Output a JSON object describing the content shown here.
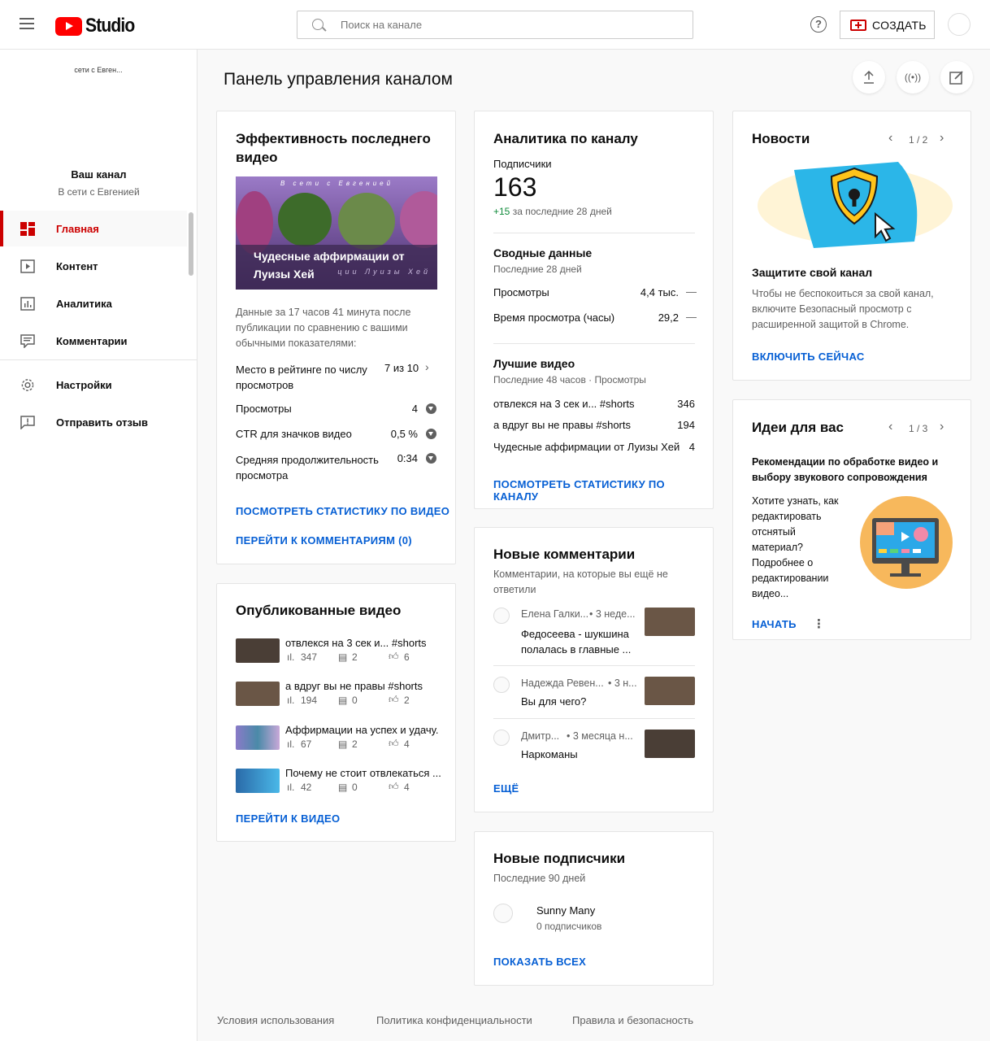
{
  "header": {
    "logo_text": "Studio",
    "search_placeholder": "Поиск на канале",
    "help_icon": "?",
    "create_label": "СОЗДАТЬ"
  },
  "sidebar": {
    "channel_thumb_text": "сети с Евген...",
    "your_channel": "Ваш канал",
    "channel_name": "В сети с Евгенией",
    "items": [
      {
        "label": "Главная",
        "icon": "dashboard-icon",
        "active": true
      },
      {
        "label": "Контент",
        "icon": "content-icon"
      },
      {
        "label": "Аналитика",
        "icon": "analytics-icon"
      },
      {
        "label": "Комментарии",
        "icon": "comments-icon"
      },
      {
        "label": "Настройки",
        "icon": "settings-icon"
      },
      {
        "label": "Отправить отзыв",
        "icon": "feedback-icon"
      }
    ]
  },
  "page": {
    "title": "Панель управления каналом"
  },
  "latest_video": {
    "title": "Эффективность последнего видео",
    "thumb_top_text": "В сети с Евгенией",
    "thumb_caption": "Чудесные аффирмации от Луизы Хей",
    "thumb_faded": "ции Луизы Хей",
    "description": "Данные за 17 часов 41 минута после публикации по сравнению с вашими обычными показателями:",
    "stats": [
      {
        "label": "Место в рейтинге по числу просмотров",
        "value": "7 из 10"
      },
      {
        "label": "Просмотры",
        "value": "4"
      },
      {
        "label": "CTR для значков видео",
        "value": "0,5 %"
      },
      {
        "label": "Средняя продолжительность просмотра",
        "value": "0:34"
      }
    ],
    "link_stats": "ПОСМОТРЕТЬ СТАТИСТИКУ ПО ВИДЕО",
    "link_comments": "ПЕРЕЙТИ К КОММЕНТАРИЯМ (0)"
  },
  "published": {
    "title": "Опубликованные видео",
    "videos": [
      {
        "title": "отвлекся на 3 сек и... #shorts",
        "views": "347",
        "comments": "2",
        "likes": "6"
      },
      {
        "title": "а вдруг вы не правы #shorts",
        "views": "194",
        "comments": "0",
        "likes": "2"
      },
      {
        "title": "Аффирмации на успех и удачу.",
        "views": "67",
        "comments": "2",
        "likes": "4"
      },
      {
        "title": "Почему не стоит отвлекаться ...",
        "views": "42",
        "comments": "0",
        "likes": "4"
      }
    ],
    "link": "ПЕРЕЙТИ К ВИДЕО"
  },
  "analytics": {
    "title": "Аналитика по каналу",
    "subs_label": "Подписчики",
    "subs_value": "163",
    "subs_delta": "+15",
    "subs_delta_text": "за последние 28 дней",
    "summary_title": "Сводные данные",
    "summary_period": "Последние 28 дней",
    "summary_rows": [
      {
        "label": "Просмотры",
        "value": "4,4 тыс.",
        "trend": "—"
      },
      {
        "label": "Время просмотра (часы)",
        "value": "29,2",
        "trend": "—"
      }
    ],
    "top_title": "Лучшие видео",
    "top_period": "Последние 48 часов · Просмотры",
    "top_rows": [
      {
        "label": "отвлекся на 3 сек и... #shorts",
        "value": "346"
      },
      {
        "label": "а вдруг вы не правы #shorts",
        "value": "194"
      },
      {
        "label": "Чудесные аффирмации от Луизы Хей",
        "value": "4"
      }
    ],
    "link": "ПОСМОТРЕТЬ СТАТИСТИКУ ПО КАНАЛУ"
  },
  "comments": {
    "title": "Новые комментарии",
    "subtitle": "Комментарии, на которые вы ещё не ответили",
    "items": [
      {
        "author": "Елена Галки...",
        "time": "• 3 неде...",
        "text": "Федосеева - шукшина полалась в главные ..."
      },
      {
        "author": "Надежда Ревен...",
        "time": "• 3 н...",
        "text": "Вы для чего?"
      },
      {
        "author": "Дмитр...",
        "time": "• 3 месяца н...",
        "text": "Наркоманы"
      }
    ],
    "link": "ЕЩЁ"
  },
  "subscribers": {
    "title": "Новые подписчики",
    "period": "Последние 90 дней",
    "name": "Sunny Many",
    "count": "0 подписчиков",
    "link": "ПОКАЗАТЬ ВСЕХ"
  },
  "news": {
    "title": "Новости",
    "pager": "1 / 2",
    "headline": "Защитите свой канал",
    "text": "Чтобы не беспокоиться за свой канал, включите Безопасный просмотр с расширенной защитой в Chrome.",
    "link": "ВКЛЮЧИТЬ СЕЙЧАС"
  },
  "ideas": {
    "title": "Идеи для вас",
    "pager": "1 / 3",
    "headline": "Рекомендации по обработке видео и выбору звукового сопровождения",
    "text": "Хотите узнать, как редактировать отснятый материал? Подробнее о редактировании видео...",
    "link": "НАЧАТЬ"
  },
  "footer": {
    "terms": "Условия использования",
    "privacy": "Политика конфиденциальности",
    "policy": "Правила и безопасность"
  },
  "colors": {
    "accent_red": "#cc0000",
    "link_blue": "#065fd4",
    "positive_green": "#0f8a3a"
  }
}
